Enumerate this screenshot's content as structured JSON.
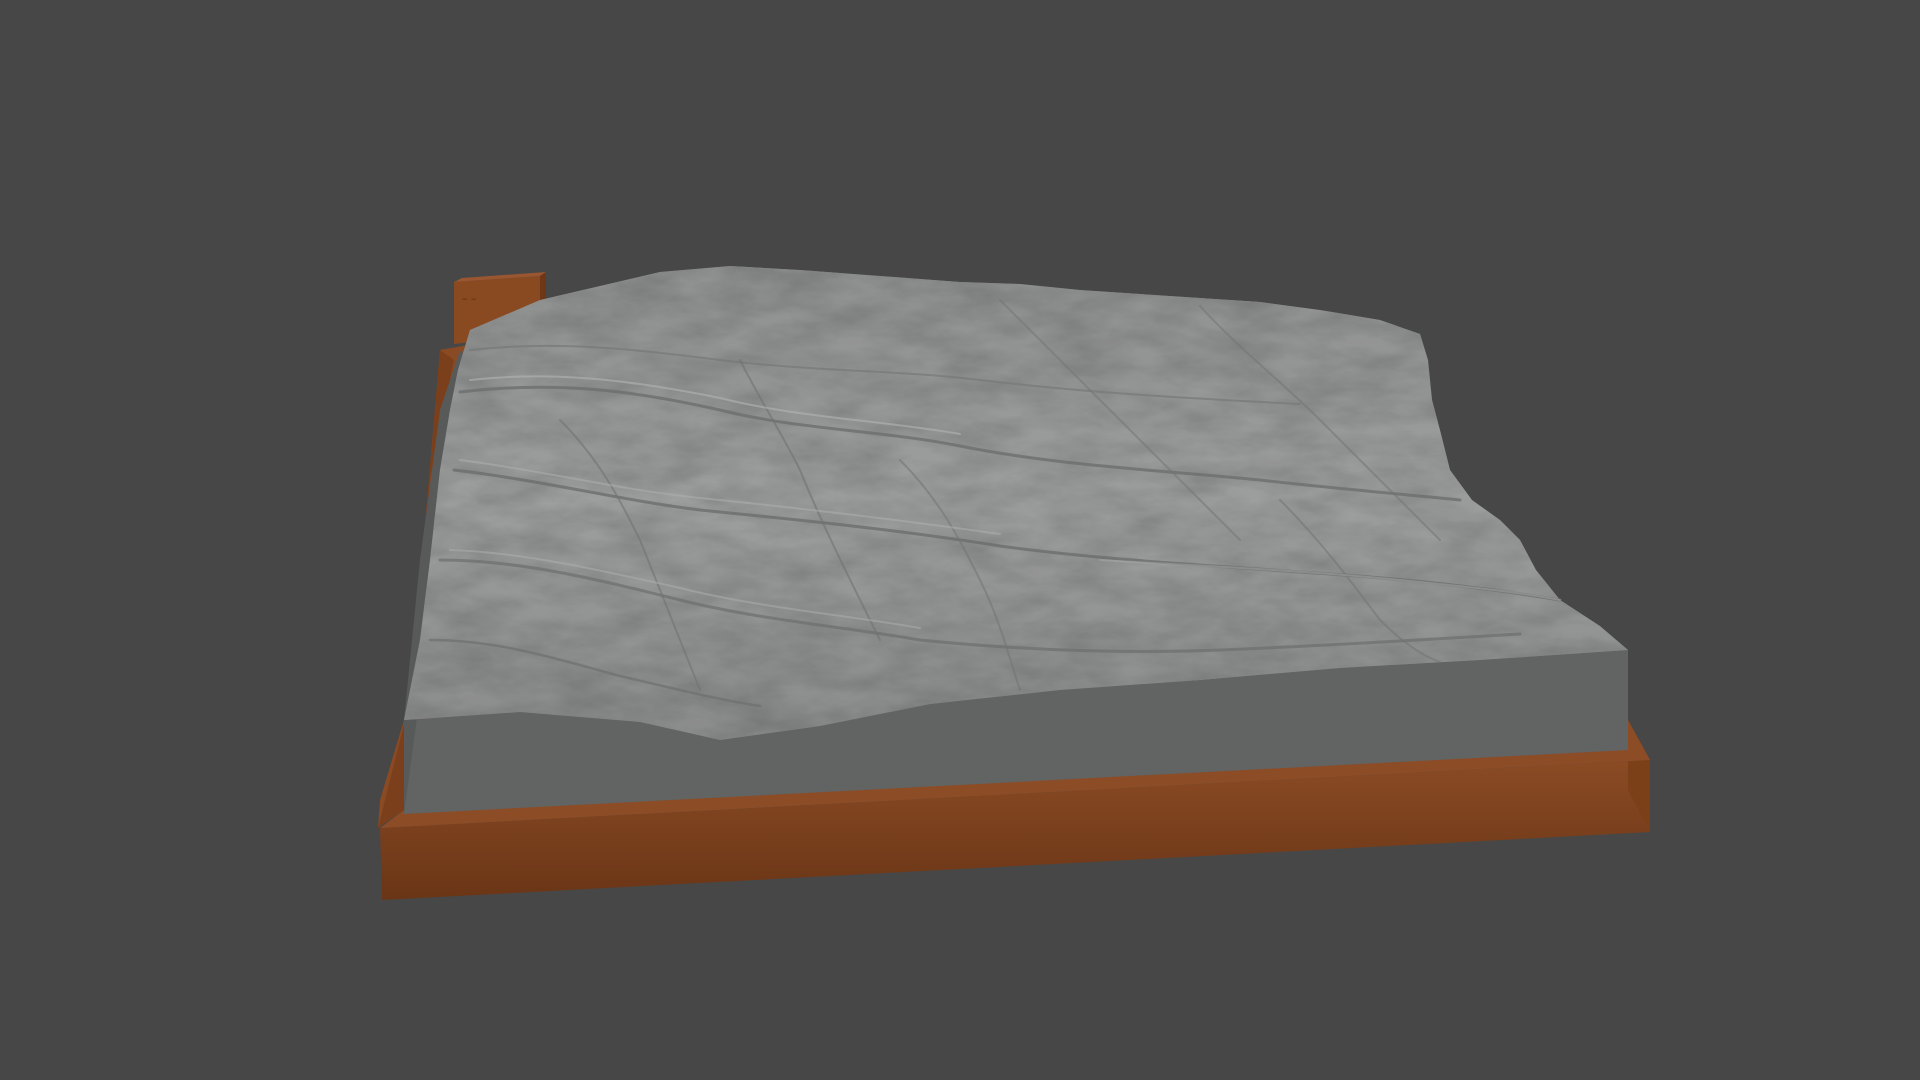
{
  "viewport": {
    "background_color": "#474747"
  },
  "model": {
    "subject": "terrain-relief-model",
    "terrain_color": "#9a9a9a",
    "terrain_side_color": "#626363",
    "base_color": "#7a4422",
    "label_plate_text": "– –"
  }
}
